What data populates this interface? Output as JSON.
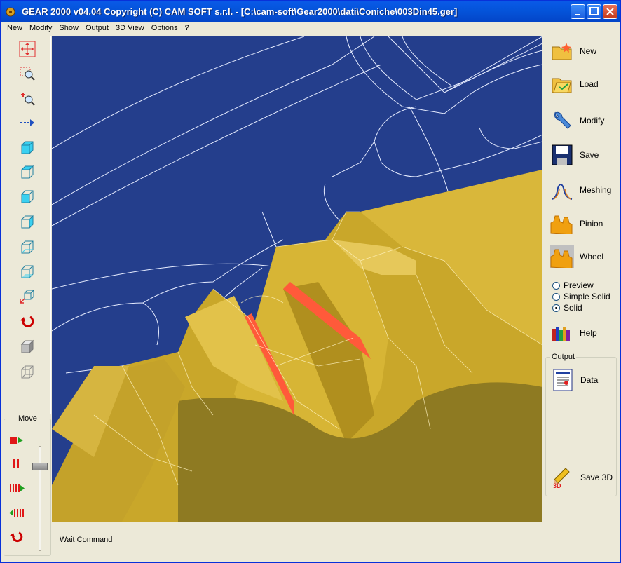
{
  "window": {
    "title": "GEAR 2000 v04.04      Copyright (C)  CAM SOFT s.r.l.  - [C:\\cam-soft\\Gear2000\\dati\\Coniche\\003Din45.ger]"
  },
  "menu": [
    "New",
    "Modify",
    "Show",
    "Output",
    "3D View",
    "Options",
    "?"
  ],
  "left_toolbar": {
    "icons": [
      "pan-icon",
      "zoom-window-icon",
      "zoom-in-out-icon",
      "move-arrow-icon",
      "view-front-icon",
      "view-top-icon",
      "view-side-icon",
      "view-right-icon",
      "view-back-icon",
      "view-bottom-icon",
      "view-iso-icon",
      "reset-rotate-icon",
      "solid-cube-icon",
      "wire-cube-icon"
    ]
  },
  "move": {
    "label": "Move",
    "buttons": [
      "stop-play-icon",
      "pause-icon",
      "forward-icon",
      "backward-icon",
      "rewind-icon"
    ]
  },
  "right_toolbar": {
    "buttons": [
      {
        "label": "New",
        "icon": "folder-new-icon"
      },
      {
        "label": "Load",
        "icon": "folder-open-icon"
      },
      {
        "label": "Modify",
        "icon": "wrench-icon"
      },
      {
        "label": "Save",
        "icon": "floppy-icon"
      },
      {
        "label": "Meshing",
        "icon": "meshing-icon"
      },
      {
        "label": "Pinion",
        "icon": "pinion-icon"
      },
      {
        "label": "Wheel",
        "icon": "wheel-icon"
      }
    ],
    "render_modes": [
      {
        "label": "Preview",
        "selected": false
      },
      {
        "label": "Simple Solid",
        "selected": false
      },
      {
        "label": "Solid",
        "selected": true
      }
    ],
    "help_label": "Help"
  },
  "output": {
    "label": "Output",
    "data_label": "Data",
    "save3d_label": "Save 3D"
  },
  "status": "Wait Command",
  "colors": {
    "viewport": "#243e8c",
    "gear": "#c9a72a",
    "accent": "#ff5a3a"
  }
}
